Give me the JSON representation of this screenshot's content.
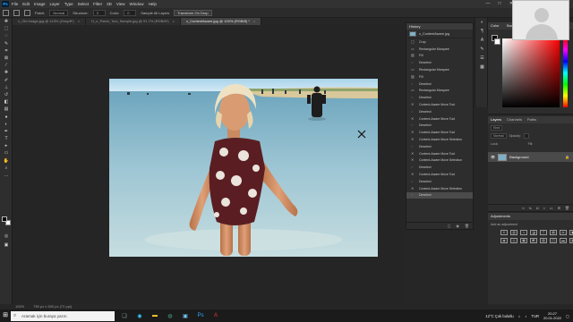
{
  "app": {
    "menu": [
      "File",
      "Edit",
      "Image",
      "Layer",
      "Type",
      "Select",
      "Filter",
      "3D",
      "View",
      "Window",
      "Help"
    ],
    "window_controls": [
      "—",
      "□",
      "✕"
    ]
  },
  "options_bar": {
    "patch_label": "Patch:",
    "patch_value": "Normal",
    "mode_label": "Structure:",
    "mode_value": "3",
    "color_label": "Color:",
    "color_value": "0",
    "sample_label": "Sample All Layers",
    "transform_button": "Transform On Drop"
  },
  "tabs": [
    {
      "label": "x_Old Image.jpg @ 113% (Gray/8*)",
      "close": "×"
    },
    {
      "label": "H_n_Patch_Tool_Sample.jpg @ 91.7% (RGB/8*)",
      "close": "×"
    },
    {
      "label": "x_ContentAware.jpg @ 100% (RGB/8) *",
      "close": "×"
    }
  ],
  "status": {
    "zoom": "100%",
    "doc_info": "750 px x 500 px (72 ppi)"
  },
  "history": {
    "title": "History",
    "snapshot": "x_ContentAware.jpg",
    "items": [
      {
        "icon": "▢",
        "label": "Crop"
      },
      {
        "icon": "▭",
        "label": "Rectangular Marquee"
      },
      {
        "icon": "▨",
        "label": "Fill"
      },
      {
        "icon": "◌",
        "label": "Deselect"
      },
      {
        "icon": "▭",
        "label": "Rectangular Marquee"
      },
      {
        "icon": "▨",
        "label": "Fill"
      },
      {
        "icon": "◌",
        "label": "Deselect"
      },
      {
        "icon": "▭",
        "label": "Rectangular Marquee"
      },
      {
        "icon": "◌",
        "label": "Deselect"
      },
      {
        "icon": "✕",
        "label": "Content-Aware Move Tool"
      },
      {
        "icon": "◌",
        "label": "Deselect"
      },
      {
        "icon": "✕",
        "label": "Content-Aware Move Tool"
      },
      {
        "icon": "◌",
        "label": "Deselect"
      },
      {
        "icon": "✕",
        "label": "Content-Aware Move Tool"
      },
      {
        "icon": "✕",
        "label": "Content-Aware Move Selection"
      },
      {
        "icon": "◌",
        "label": "Deselect"
      },
      {
        "icon": "✕",
        "label": "Content-Aware Move Tool"
      },
      {
        "icon": "✕",
        "label": "Content-Aware Move Selection"
      },
      {
        "icon": "◌",
        "label": "Deselect"
      },
      {
        "icon": "✕",
        "label": "Content-Aware Move Tool"
      },
      {
        "icon": "◌",
        "label": "Deselect"
      },
      {
        "icon": "✕",
        "label": "Content-Aware Move Selection"
      },
      {
        "icon": "◌",
        "label": "Deselect"
      }
    ],
    "selected_index": 22
  },
  "color_panel": {
    "tabs": [
      "Color",
      "Swatches"
    ],
    "color_space": "RGB"
  },
  "layers_panel": {
    "tabs": [
      "Layers",
      "Channels",
      "Paths"
    ],
    "kind": "Kind",
    "blend": "Normal",
    "opacity": "Opacity:",
    "fill": "Fill:",
    "lock": "Lock:",
    "layer_name": "Background"
  },
  "adjustments": {
    "title": "Adjustments",
    "subtitle": "Add an adjustment"
  },
  "taskbar": {
    "search_placeholder": "Aramak için buraya yazın",
    "weather": "12°C Çok bulutlu",
    "lang": "TUR",
    "time": "20:27",
    "date": "20.01.2022"
  },
  "colors": {
    "app_bg": "#262626",
    "panel_bg": "#2d2d2d",
    "ps_blue": "#31a8ff",
    "sea": "#86b9cd",
    "sky": "#c9e4f0",
    "swimsuit": "#5a1e22"
  }
}
